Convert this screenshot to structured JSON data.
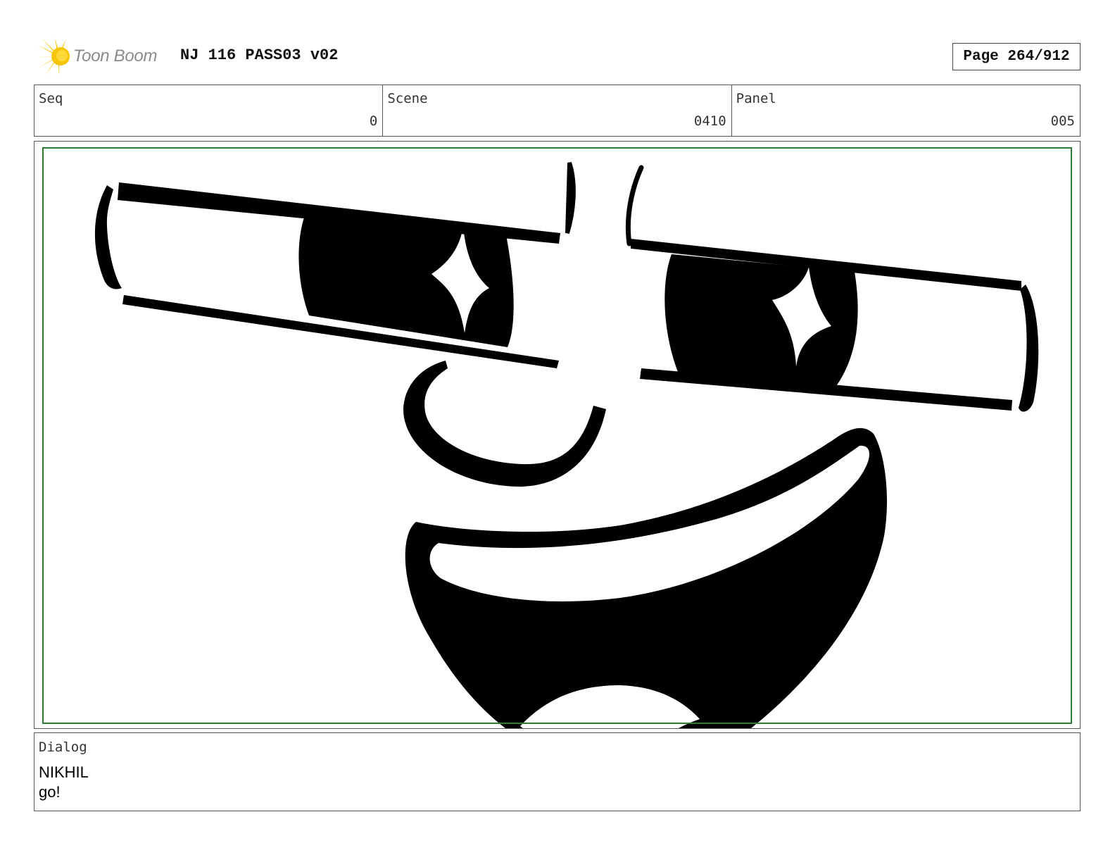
{
  "header": {
    "logo_text": "Toon Boom",
    "title": "NJ 116 PASS03 v02",
    "page_label": "Page 264/912"
  },
  "info": {
    "seq_label": "Seq",
    "seq_value": "0",
    "scene_label": "Scene",
    "scene_value": "0410",
    "panel_label": "Panel",
    "panel_value": "005"
  },
  "dialog": {
    "label": "Dialog",
    "character": "NIKHIL",
    "line": "go!"
  },
  "colors": {
    "safe_frame": "#2e7d32",
    "ink": "#000000",
    "logo_burst": "#f6c400"
  }
}
